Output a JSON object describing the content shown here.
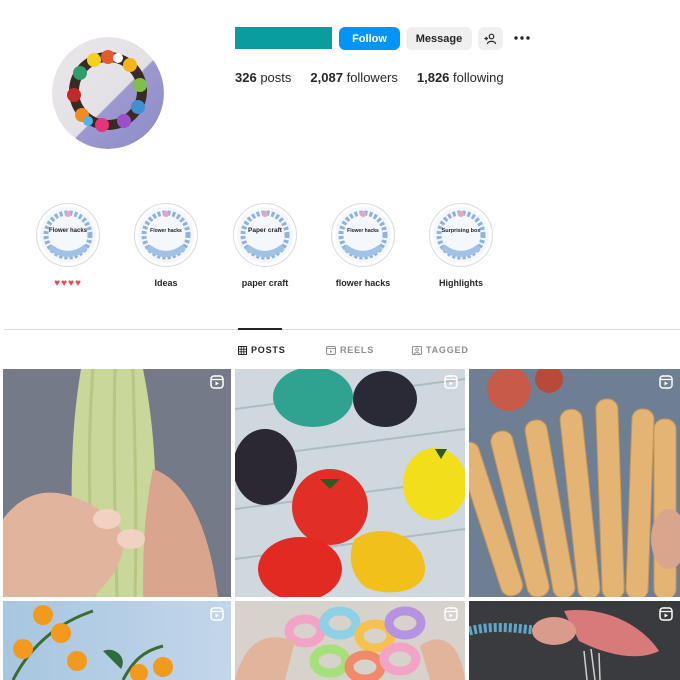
{
  "profile": {
    "username_redacted_color": "#0a9d9f",
    "follow_label": "Follow",
    "message_label": "Message",
    "stats": [
      {
        "value": "326",
        "label": "posts"
      },
      {
        "value": "2,087",
        "label": "followers"
      },
      {
        "value": "1,826",
        "label": "following"
      }
    ]
  },
  "highlights": [
    {
      "cover_title": "Flower hacks",
      "label": "♥♥♥♥"
    },
    {
      "cover_title": "Flower hacks",
      "label": "Ideas"
    },
    {
      "cover_title": "Paper craft",
      "label": "paper craft"
    },
    {
      "cover_title": "Flower hacks",
      "label": "flower hacks"
    },
    {
      "cover_title": "Surprising box",
      "label": "Highlights"
    }
  ],
  "tabs": [
    {
      "label": "POSTS",
      "icon": "grid-icon",
      "active": true
    },
    {
      "label": "REELS",
      "icon": "reels-icon",
      "active": false
    },
    {
      "label": "TAGGED",
      "icon": "tagged-icon",
      "active": false
    }
  ],
  "grid": [
    {
      "subject": "corn",
      "type": "reel"
    },
    {
      "subject": "peppers",
      "type": "reel"
    },
    {
      "subject": "popsicle-sticks",
      "type": "reel"
    },
    {
      "subject": "orange-flowers",
      "type": "reel"
    },
    {
      "subject": "rings",
      "type": "reel"
    },
    {
      "subject": "sugar-craft",
      "type": "reel"
    }
  ],
  "colors": {
    "accent": "#0095f6",
    "heart": "#ed4956"
  }
}
